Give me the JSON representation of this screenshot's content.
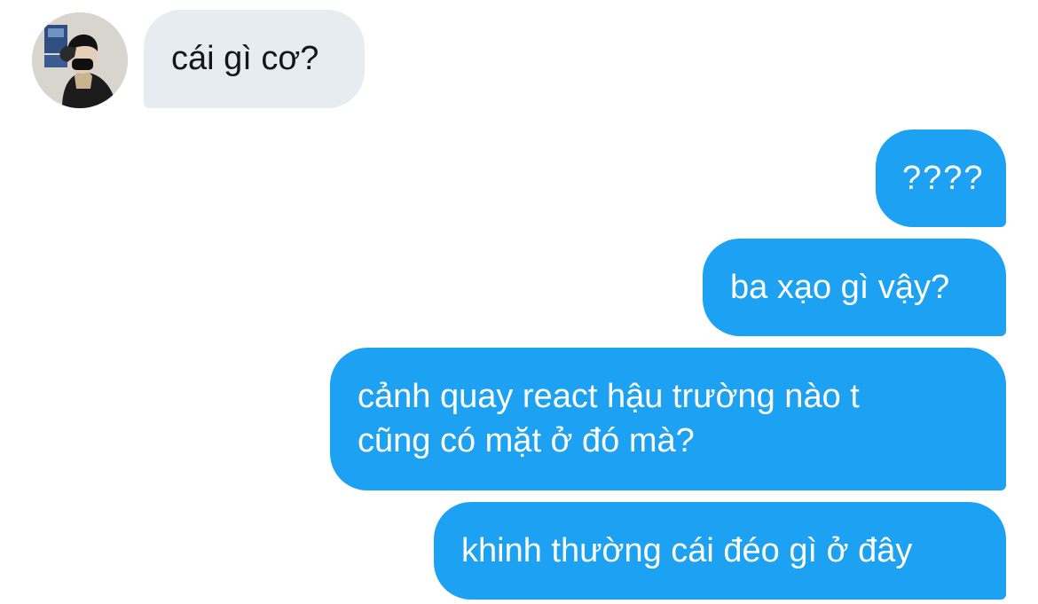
{
  "conversation": {
    "contact": {
      "avatar_icon": "profile-photo"
    },
    "messages": [
      {
        "sender": "contact",
        "lines": [
          "cái gì cơ?"
        ]
      },
      {
        "sender": "me",
        "lines": [
          "????"
        ]
      },
      {
        "sender": "me",
        "lines": [
          "ba xạo gì vậy?"
        ]
      },
      {
        "sender": "me",
        "lines": [
          "cảnh quay react hậu trường nào t",
          "cũng có mặt ở đó mà?"
        ]
      },
      {
        "sender": "me",
        "lines": [
          "khinh thường cái đéo gì ở đây"
        ]
      }
    ]
  },
  "colors": {
    "sent_bubble": "#1da1f2",
    "received_bubble": "#e6ecf0",
    "received_text": "#14171a",
    "sent_text": "#ffffff"
  }
}
